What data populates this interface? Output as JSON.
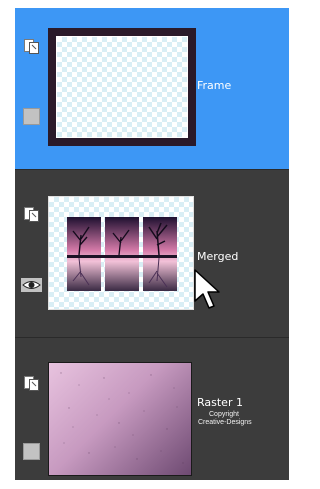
{
  "layers": [
    {
      "name": "Frame",
      "selected": true,
      "visible": false
    },
    {
      "name": "Merged",
      "selected": false,
      "visible": true
    },
    {
      "name": "Raster 1",
      "selected": false,
      "visible": false
    }
  ],
  "watermark": {
    "line1": "Copyright",
    "line2": "Creative-Designs"
  },
  "icons": {
    "layer_type": "layer-link-icon",
    "visibility_on": "eye-icon",
    "visibility_off": "visibility-toggle-box",
    "cursor": "mouse-pointer-icon"
  },
  "colors": {
    "selected_bg": "#3d97f5",
    "panel_bg": "#3c3c3c",
    "text": "#ffffff"
  }
}
